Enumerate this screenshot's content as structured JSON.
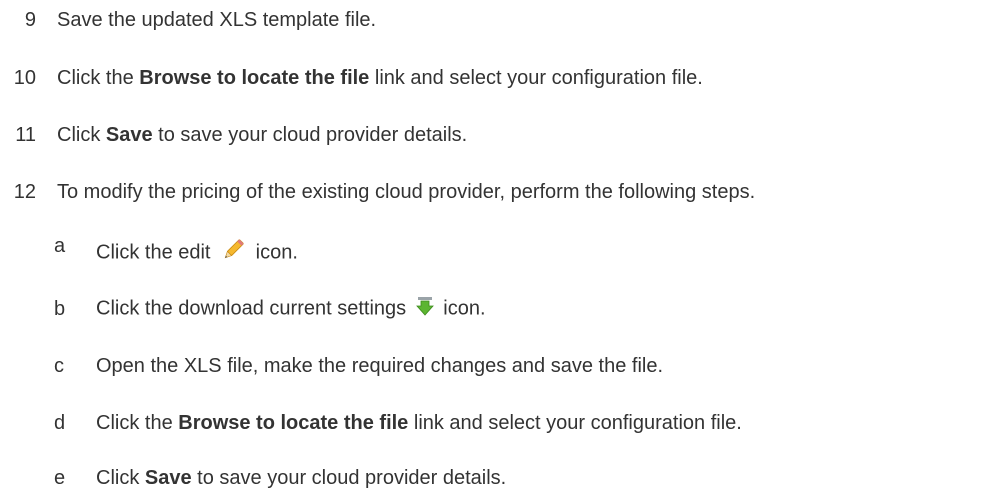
{
  "steps": [
    {
      "number": "9",
      "parts": [
        "Save the updated XLS template file.",
        "",
        ""
      ]
    },
    {
      "number": "10",
      "parts": [
        "Click the ",
        "Browse to locate the file",
        " link and select your configuration file."
      ]
    },
    {
      "number": "11",
      "parts": [
        "Click ",
        "Save",
        " to save your cloud provider details."
      ]
    },
    {
      "number": "12",
      "parts": [
        "To modify the pricing of the existing cloud provider, perform the following steps.",
        "",
        ""
      ]
    }
  ],
  "substeps": [
    {
      "letter": "a",
      "before": "Click the edit",
      "icon": "pencil-icon",
      "after": "icon."
    },
    {
      "letter": "b",
      "before": "Click the download current settings",
      "icon": "download-arrow-icon",
      "after": "icon."
    },
    {
      "letter": "c",
      "text": "Open the XLS file, make the required changes and save the file."
    },
    {
      "letter": "d",
      "parts": [
        "Click the ",
        "Browse to locate the file",
        " link and select your configuration file."
      ]
    },
    {
      "letter": "e",
      "parts": [
        "Click ",
        "Save",
        " to save your cloud provider details."
      ]
    }
  ],
  "colors": {
    "text": "#333333",
    "pencil_body": "#f5b82e",
    "pencil_tip": "#f2d9a5",
    "download_arrow": "#5cb531"
  }
}
